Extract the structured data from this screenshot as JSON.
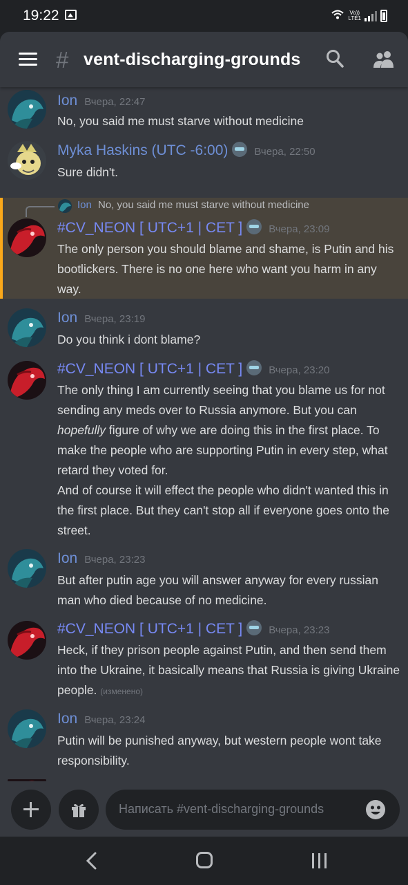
{
  "status": {
    "time": "19:22",
    "network": "LTE1"
  },
  "header": {
    "hash": "#",
    "channel": "vent-discharging-grounds"
  },
  "reply": {
    "author": "Ion",
    "text": "No, you said me must starve without medicine"
  },
  "messages": [
    {
      "author": "Ion",
      "time": "Вчера, 22:47",
      "text": "No, you said me must starve without medicine"
    },
    {
      "author": "Myka Haskins (UTC -6:00)",
      "time": "Вчера, 22:50",
      "text": "Sure didn't."
    },
    {
      "author": "#CV_NEON [ UTC+1 | CET ]",
      "time": "Вчера, 23:09",
      "text": "The only person you should blame and shame, is Putin and his bootlickers. There is no one here who want you harm in any way."
    },
    {
      "author": "Ion",
      "time": "Вчера, 23:19",
      "text": "Do you think i dont blame?"
    },
    {
      "author": "#CV_NEON [ UTC+1 | CET ]",
      "time": "Вчера, 23:20",
      "text_a": "The only thing I am currently seeing that you blame us for not sending any meds over to Russia anymore. But you can ",
      "text_em": "hopefully",
      "text_b": " figure of why we are doing this in the first place. To make the people who are supporting Putin in every step, what retard they voted for.",
      "text_c": "And of course it will effect the people who didn't wanted this in the first place. But they can't stop all if everyone goes onto the street."
    },
    {
      "author": "Ion",
      "time": "Вчера, 23:23",
      "text": "But after putin age you will answer anyway for every russian man who died because of no medicine."
    },
    {
      "author": "#CV_NEON [ UTC+1 | CET ]",
      "time": "Вчера, 23:23",
      "text": "Heck, if they prison people against Putin, and then send them into the Ukraine, it basically means that Russia is giving Ukraine people.",
      "edited": "(изменено)"
    },
    {
      "author": "Ion",
      "time": "Вчера, 23:24",
      "text": "Putin will be punished anyway, but western people wont take responsibility."
    }
  ],
  "input": {
    "placeholder": "Написать #vent-discharging-grounds"
  },
  "colors": {
    "background": "#36393f",
    "highlight": "#49443c",
    "highlight_bar": "#faa81a",
    "username_blue": "#6e8fd6",
    "username_purple": "#7789f3"
  },
  "icons": [
    "menu-icon",
    "search-icon",
    "members-icon",
    "plus-icon",
    "gift-icon",
    "emoji-icon",
    "back-icon",
    "home-icon",
    "recents-icon"
  ]
}
